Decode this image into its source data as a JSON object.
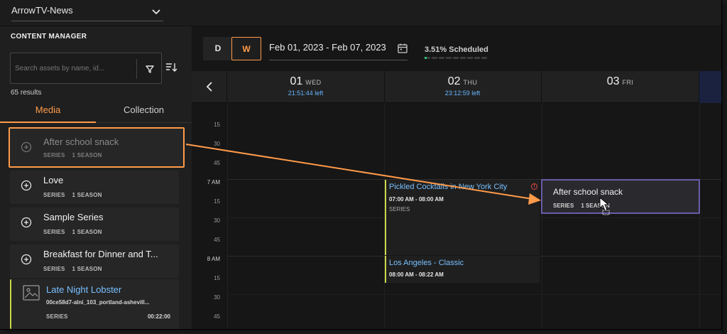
{
  "channel": {
    "selected": "ArrowTV-News"
  },
  "content_manager": {
    "title": "CONTENT MANAGER",
    "search_placeholder": "Search assets by name, id...",
    "results": "65 results",
    "tabs": [
      {
        "label": "Media"
      },
      {
        "label": "Collection"
      }
    ],
    "items": [
      {
        "name": "After school snack",
        "type": "SERIES",
        "seasons": "1 SEASON"
      },
      {
        "name": "Love",
        "type": "SERIES",
        "seasons": "1 SEASON"
      },
      {
        "name": "Sample Series",
        "type": "SERIES",
        "seasons": "1 SEASON"
      },
      {
        "name": "Breakfast for Dinner and T...",
        "type": "SERIES",
        "seasons": "1 SEASON"
      },
      {
        "name": "Late Night Lobster",
        "file": "00ce58d7-alni_103_portland-ashevill...",
        "type": "SERIES",
        "duration": "00:22:00"
      }
    ]
  },
  "toolbar": {
    "view_day": "D",
    "view_week": "W",
    "date_range": "Feb 01, 2023 - Feb 07, 2023",
    "scheduled": "3.51% Scheduled",
    "scheduled_fraction": 0.0351
  },
  "calendar": {
    "days": [
      {
        "num": "01",
        "dow": "WED",
        "left": "21:51:44 left"
      },
      {
        "num": "02",
        "dow": "THU",
        "left": "23:12:59 left"
      },
      {
        "num": "03",
        "dow": "FRI",
        "left": ""
      }
    ],
    "time_labels": [
      "15",
      "30",
      "45",
      "7 AM",
      "15",
      "30",
      "45",
      "8 AM",
      "15",
      "30",
      "45"
    ],
    "events": [
      {
        "title": "Pickled Cocktails in New York City",
        "time": "07:00 AM - 08:00 AM",
        "type": "SERIES",
        "warn": "!"
      },
      {
        "title": "Los Angeles - Classic",
        "time": "08:00 AM - 08:22 AM"
      }
    ],
    "drop_preview": {
      "name": "After school snack",
      "type": "SERIES",
      "seasons": "1 SEASON"
    }
  },
  "colors": {
    "accent": "#ff9b4a",
    "link": "#78c0ff",
    "event_bar": "#c9d84a",
    "drop_border": "#6a5ca8",
    "warning": "#e04848"
  }
}
